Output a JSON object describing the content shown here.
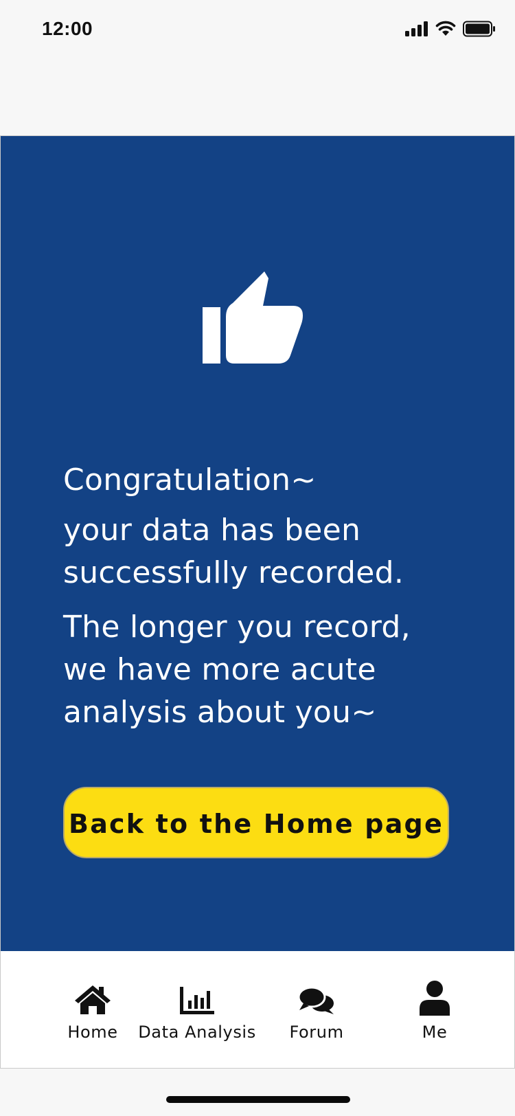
{
  "status_bar": {
    "time": "12:00",
    "icons": [
      "signal-icon",
      "wifi-icon",
      "battery-icon"
    ]
  },
  "colors": {
    "panel_background": "#134285",
    "button_background": "#fcdd12",
    "text_on_panel": "#ffffff"
  },
  "main": {
    "icon": "thumbs-up-icon",
    "line_congrats": "Congratulation~",
    "line_recorded": "your data has been\nsuccessfully recorded.",
    "line_longer": "The longer you record,\nwe have more acute\nanalysis about you~",
    "button_label": "Back to the Home page"
  },
  "tab_bar": {
    "items": [
      {
        "label": "Home",
        "icon": "home-icon"
      },
      {
        "label": "Data Analysis",
        "icon": "bar-chart-icon"
      },
      {
        "label": "Forum",
        "icon": "chat-bubbles-icon"
      },
      {
        "label": "Me",
        "icon": "user-icon"
      }
    ]
  }
}
